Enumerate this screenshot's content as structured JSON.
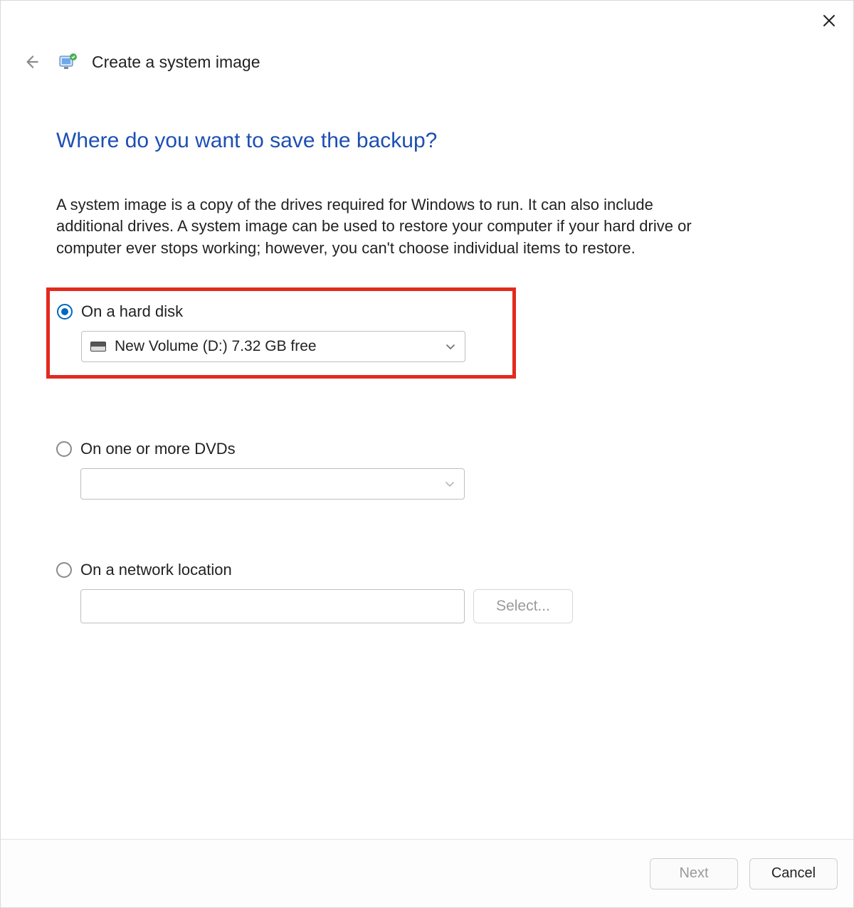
{
  "header": {
    "title": "Create a system image"
  },
  "page": {
    "heading": "Where do you want to save the backup?",
    "description": "A system image is a copy of the drives required for Windows to run. It can also include additional drives. A system image can be used to restore your computer if your hard drive or computer ever stops working; however, you can't choose individual items to restore."
  },
  "options": {
    "hard_disk": {
      "label": "On a hard disk",
      "selected": true,
      "dropdown_value": "New Volume (D:)  7.32 GB free"
    },
    "dvds": {
      "label": "On one or more DVDs",
      "selected": false,
      "dropdown_value": ""
    },
    "network": {
      "label": "On a network location",
      "selected": false,
      "path_value": "",
      "select_button": "Select..."
    }
  },
  "footer": {
    "next": "Next",
    "cancel": "Cancel"
  }
}
